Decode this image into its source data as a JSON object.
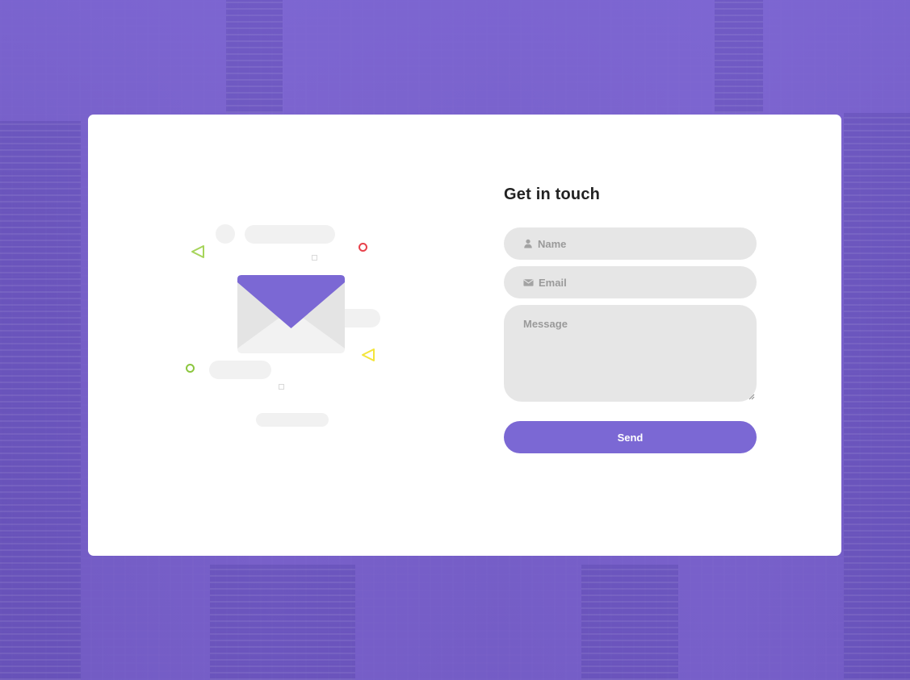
{
  "contact": {
    "title": "Get in touch",
    "name_placeholder": "Name",
    "email_placeholder": "Email",
    "message_placeholder": "Message",
    "send_label": "Send"
  },
  "icons": {
    "name_field": "user-icon",
    "email_field": "envelope-icon",
    "illustration": "envelope-illustration"
  },
  "colors": {
    "accent": "#7b68d4",
    "background": "#7b66cf",
    "card": "#ffffff",
    "input_bg": "#e6e6e6",
    "placeholder": "#9a9a9a",
    "title": "#222222",
    "decor_green": "#8cc63f",
    "decor_yellow": "#f4e53b",
    "decor_red": "#e8414b"
  }
}
